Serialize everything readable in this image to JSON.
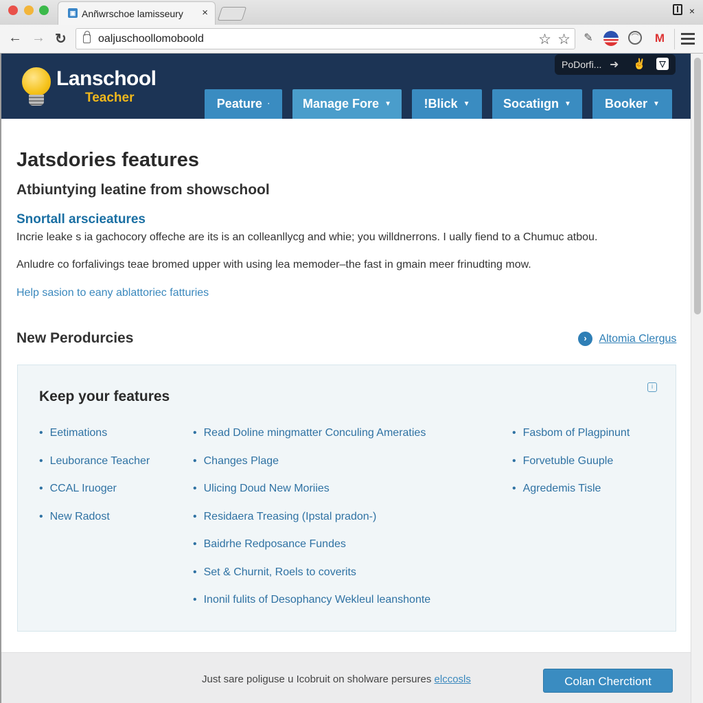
{
  "browser": {
    "tab_title": "Anñwrschoe lamisseury",
    "tab_favicon": "lanschool-favicon",
    "url": "oaljuschoollomoboold",
    "nav": {
      "back": "←",
      "forward": "→",
      "reload": "↻"
    },
    "toolbar_icons": [
      "star-icon",
      "star-icon",
      "extension-icon",
      "flag-extension-icon",
      "circle-extension-icon",
      "mail-extension-icon",
      "menu-icon"
    ],
    "glyphs": {
      "star": "☆",
      "close": "×",
      "ext1": "✎",
      "ext3": "⌒",
      "ext4": "M"
    }
  },
  "header": {
    "logo_name": "Lanschool",
    "logo_sub": "Teacher",
    "pill_text": "PoDorfi...",
    "pill_arrow": "➜",
    "pill_icon1": "✌",
    "pill_icon2": "▽",
    "nav_tabs": [
      {
        "label": "Peature",
        "caret": "·"
      },
      {
        "label": "Manage Fore",
        "caret": "▼"
      },
      {
        "label": "!Blick",
        "caret": "▼"
      },
      {
        "label": "Socatiıgn",
        "caret": "▼"
      },
      {
        "label": "Booker",
        "caret": "▼"
      }
    ]
  },
  "main": {
    "title": "Jatsdories features",
    "subtitle": "Atbiuntying leatine from showschool",
    "section_heading": "Snortall arscieatures",
    "paragraph1": "Incrie leake s ia gachocory offeche are its is an colleanllycg and whie; you willdnerrons. I ually fiend to a Chumuc atbou.",
    "paragraph2": "Anludre co forfalivings teae bromed upper with using lea memoder–the fast in gmain meer frinudting mow.",
    "help_link": "Help sasion to eany ablattoriec fatturies",
    "new_section_title": "New Perodurcies",
    "side_link_icon": "›",
    "side_link": "Altomia Clergus"
  },
  "feature_box": {
    "title": "Keep your features",
    "info_icon": "i",
    "columns": [
      [
        "Eetimations",
        "Leuborance Teacher",
        "CCAL Iruoger",
        "New Radost"
      ],
      [
        "Read Doline mingmatter Conculing Ameraties",
        "Changes Plage",
        "Ulicing Doud New Moriies",
        "Residaera Treasing (Ipstal pradon-)",
        "Baidrhe Redposance Fundes",
        "Set & Churnit, Roels to coverits",
        "Inonil fulits of Desophancy Wekleul leanshonte"
      ],
      [
        "Fasbom of Plagpinunt",
        "Forvetuble Guuple",
        "Agredemis Tisle"
      ]
    ]
  },
  "footer": {
    "text": "Just sare poliguse u Icobruit on sholware persures ",
    "link": "elccosls",
    "cta": "Colan Cherctiont"
  },
  "colors": {
    "header_bg": "#1c3455",
    "tab_bg": "#3a8cc1",
    "accent_link": "#2f72a3",
    "logo_yellow": "#f0b81c"
  }
}
